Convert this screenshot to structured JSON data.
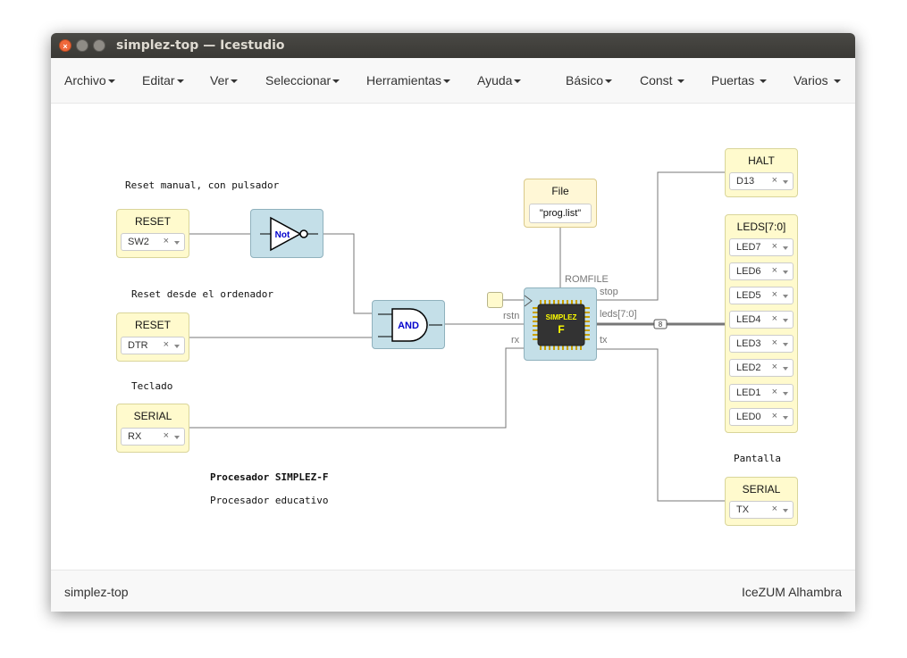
{
  "window": {
    "title": "simplez-top — Icestudio"
  },
  "menu": {
    "archivo": "Archivo",
    "editar": "Editar",
    "ver": "Ver",
    "seleccionar": "Seleccionar",
    "herramientas": "Herramientas",
    "ayuda": "Ayuda",
    "basico": "Básico",
    "const": "Const",
    "puertas": "Puertas",
    "varios": "Varios"
  },
  "notes": {
    "reset_manual": "Reset manual, con pulsador",
    "reset_ordenador": "Reset desde el ordenador",
    "teclado": "Teclado",
    "procesador": "Procesador SIMPLEZ-F",
    "educativo": "Procesador educativo",
    "pantalla": "Pantalla"
  },
  "inputs": {
    "reset1": {
      "title": "RESET",
      "value": "SW2"
    },
    "reset2": {
      "title": "RESET",
      "value": "DTR"
    },
    "serial_in": {
      "title": "SERIAL",
      "value": "RX"
    }
  },
  "gates": {
    "not": "Not",
    "and": "AND"
  },
  "const_file": {
    "title": "File",
    "value": "\"prog.list\""
  },
  "chip": {
    "name_line1": "SIMPLEZ",
    "name_line2": "F",
    "romfile": "ROMFILE",
    "rstn": "rstn",
    "rx": "rx",
    "stop": "stop",
    "leds": "leds[7:0]",
    "tx": "tx"
  },
  "bus_width": "8",
  "outputs": {
    "halt": {
      "title": "HALT",
      "value": "D13"
    },
    "leds": {
      "title": "LEDS[7:0]",
      "values": [
        "LED7",
        "LED6",
        "LED5",
        "LED4",
        "LED3",
        "LED2",
        "LED1",
        "LED0"
      ]
    },
    "serial_out": {
      "title": "SERIAL",
      "value": "TX"
    }
  },
  "footer": {
    "left": "simplez-top",
    "right": "IceZUM Alhambra"
  },
  "colors": {
    "io_block": "#fffacd",
    "gate_block": "#c4dfe8",
    "chip_body": "#333333",
    "chip_text": "#ffff00",
    "wire": "#777777"
  }
}
